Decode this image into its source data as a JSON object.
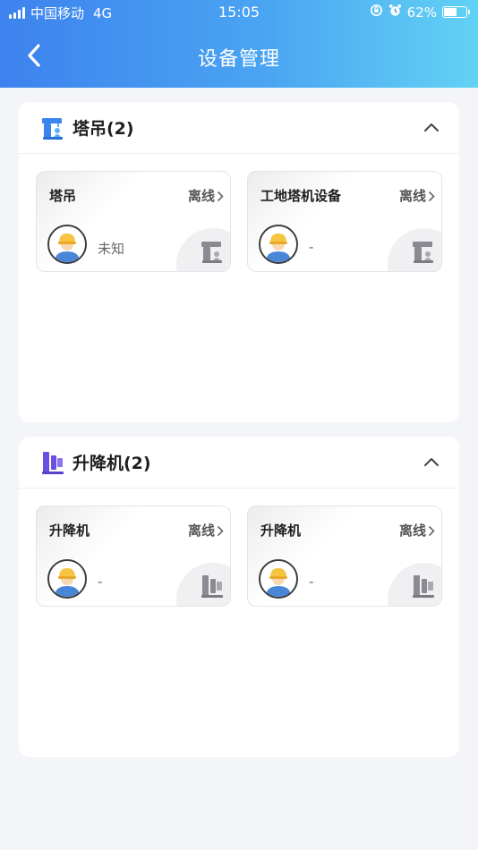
{
  "status_bar": {
    "carrier": "中国移动",
    "network": "4G",
    "time": "15:05",
    "battery": "62%",
    "battery_level": 0.62
  },
  "nav": {
    "title": "设备管理",
    "back_icon": "chevron-left-icon"
  },
  "sections": [
    {
      "title": "塔吊(2)",
      "icon": "tower-crane-icon",
      "toggle_icon": "chevron-up-icon",
      "devices": [
        {
          "name": "塔吊",
          "status": "离线",
          "person": "未知",
          "avatar_icon": "worker-avatar-icon",
          "badge_icon": "tower-crane-icon"
        },
        {
          "name": "工地塔机设备",
          "status": "离线",
          "person": "-",
          "avatar_icon": "worker-avatar-icon",
          "badge_icon": "tower-crane-icon"
        }
      ]
    },
    {
      "title": "升降机(2)",
      "icon": "elevator-icon",
      "toggle_icon": "chevron-up-icon",
      "devices": [
        {
          "name": "升降机",
          "status": "离线",
          "person": "-",
          "avatar_icon": "worker-avatar-icon",
          "badge_icon": "elevator-icon"
        },
        {
          "name": "升降机",
          "status": "离线",
          "person": "-",
          "avatar_icon": "worker-avatar-icon",
          "badge_icon": "elevator-icon"
        }
      ]
    }
  ],
  "colors": {
    "header_start": "#3d82ee",
    "header_end": "#62d2f4",
    "crane_icon": "#3b86ec",
    "elevator_icon": "#6a4fe0",
    "badge_gray": "#8a8a92",
    "helmet": "#f5c542",
    "shirt": "#4a86d8"
  }
}
